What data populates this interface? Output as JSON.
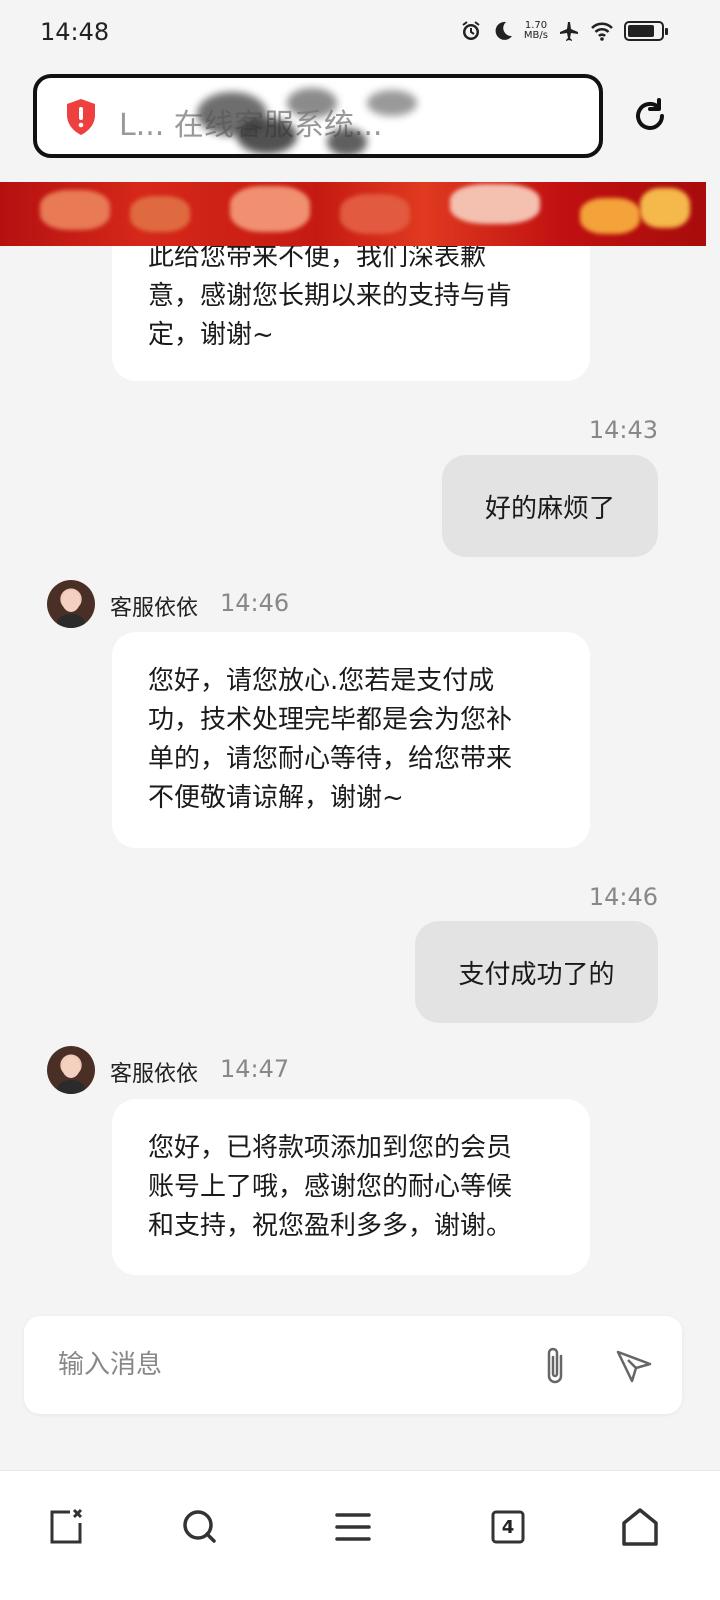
{
  "status_bar": {
    "time": "14:48",
    "net_speed_value": "1.70",
    "net_speed_unit": "MB/s"
  },
  "browser": {
    "address_text": "L... 在线客服系统..."
  },
  "messages": [
    {
      "role": "agent",
      "text": "此给您带来不便，我们深表歉意，感谢您长期以来的支持与肯定，谢谢~"
    },
    {
      "role": "user",
      "time": "14:43",
      "text": "好的麻烦了"
    },
    {
      "role": "agent",
      "name": "客服依依",
      "time": "14:46",
      "text": "您好，请您放心.您若是支付成功，技术处理完毕都是会为您补单的，请您耐心等待，给您带来不便敬请谅解，谢谢~"
    },
    {
      "role": "user",
      "time": "14:46",
      "text": "支付成功了的"
    },
    {
      "role": "agent",
      "name": "客服依依",
      "time": "14:47",
      "text": "您好，已将款项添加到您的会员账号上了哦，感谢您的耐心等候和支持，祝您盈利多多，谢谢。"
    }
  ],
  "message_lines": {
    "m0": [
      "此给您带来不便，我们深表歉",
      "意，感谢您长期以来的支持与肯",
      "定，谢谢~"
    ],
    "m2": [
      "您好，请您放心.您若是支付成",
      "功，技术处理完毕都是会为您补",
      "单的，请您耐心等待，给您带来",
      "不便敬请谅解，谢谢~"
    ],
    "m4": [
      "您好，已将款项添加到您的会员",
      "账号上了哦，感谢您的耐心等候",
      "和支持，祝您盈利多多，谢谢。"
    ]
  },
  "input": {
    "placeholder": "输入消息"
  },
  "bottom_nav": {
    "tabs_count": "4"
  },
  "colors": {
    "accent_red": "#c51a12",
    "shield_red": "#ef4040",
    "user_bubble": "#e3e3e3",
    "agent_bubble": "#ffffff",
    "background": "#f4f4f4"
  }
}
